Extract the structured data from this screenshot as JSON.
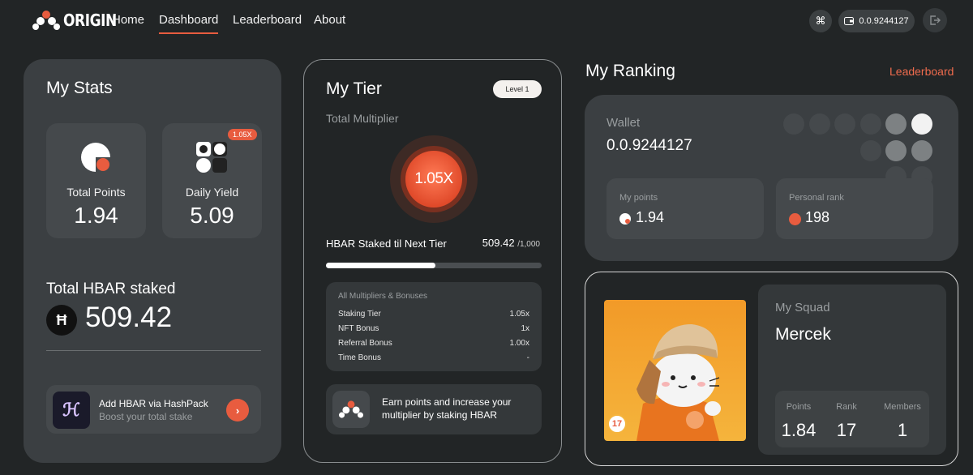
{
  "nav": {
    "brand": "ORIGIN",
    "links": [
      "Home",
      "Dashboard",
      "Leaderboard",
      "About"
    ],
    "active": "Dashboard",
    "wallet_balance": "0.0.9244127"
  },
  "colors": {
    "accent": "#e85c3f",
    "background": "#222526",
    "card": "#3b3f42"
  },
  "stats": {
    "title": "My Stats",
    "total_points_label": "Total Points",
    "total_points_value": "1.94",
    "daily_yield_label": "Daily Yield",
    "daily_yield_value": "5.09",
    "daily_yield_badge": "1.05X",
    "hbar_staked_label": "Total HBAR staked",
    "hbar_symbol": "Ħ",
    "hbar_staked_value": "509.42",
    "hashpack_title": "Add HBAR via HashPack",
    "hashpack_subtitle": "Boost your total stake"
  },
  "tier": {
    "title": "My Tier",
    "level": "Level 1",
    "multiplier_label": "Total Multiplier",
    "multiplier_value": "1.05X",
    "staked_label": "HBAR Staked til Next Tier",
    "staked_value": "509.42",
    "staked_target": "/1,000",
    "progress_fraction": 0.509,
    "bonuses_title": "All Multipliers & Bonuses",
    "bonuses": [
      {
        "label": "Staking Tier",
        "value": "1.05x"
      },
      {
        "label": "NFT Bonus",
        "value": "1x"
      },
      {
        "label": "Referral Bonus",
        "value": "1.00x"
      },
      {
        "label": "Time Bonus",
        "value": "-"
      }
    ],
    "earn_text": "Earn points and increase your multiplier by staking HBAR"
  },
  "ranking": {
    "title": "My Ranking",
    "leaderboard_link": "Leaderboard",
    "wallet_label": "Wallet",
    "wallet_value": "0.0.9244127",
    "my_points_label": "My points",
    "my_points_value": "1.94",
    "personal_rank_label": "Personal rank",
    "personal_rank_value": "198"
  },
  "squad": {
    "nft_badge": "17",
    "label": "My Squad",
    "name": "Mercek",
    "points_label": "Points",
    "points_value": "1.84",
    "rank_label": "Rank",
    "rank_value": "17",
    "members_label": "Members",
    "members_value": "1"
  }
}
